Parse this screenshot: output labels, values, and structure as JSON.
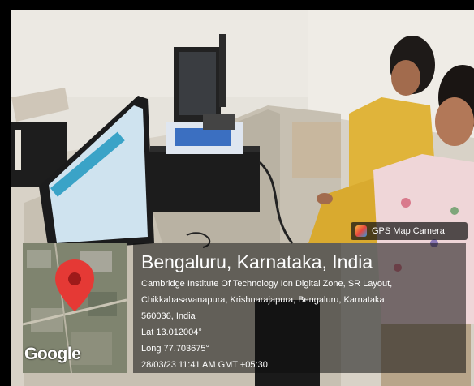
{
  "badge": {
    "label": "GPS Map Camera",
    "icon": "gps-map-camera-icon"
  },
  "map": {
    "watermark": "Google",
    "pin_color": "#e53935",
    "pin_icon": "location-pin-icon"
  },
  "location": {
    "title": "Bengaluru, Karnataka, India",
    "address_line1": "Cambridge Institute Of Technology Ion Digital Zone, SR Layout,",
    "address_line2": "Chikkabasavanapura, Krishnarajapura, Bengaluru, Karnataka",
    "address_line3": "560036, India",
    "lat": "Lat 13.012004°",
    "long": "Long 77.703675°",
    "datetime": "28/03/23 11:41 AM GMT +05:30"
  }
}
